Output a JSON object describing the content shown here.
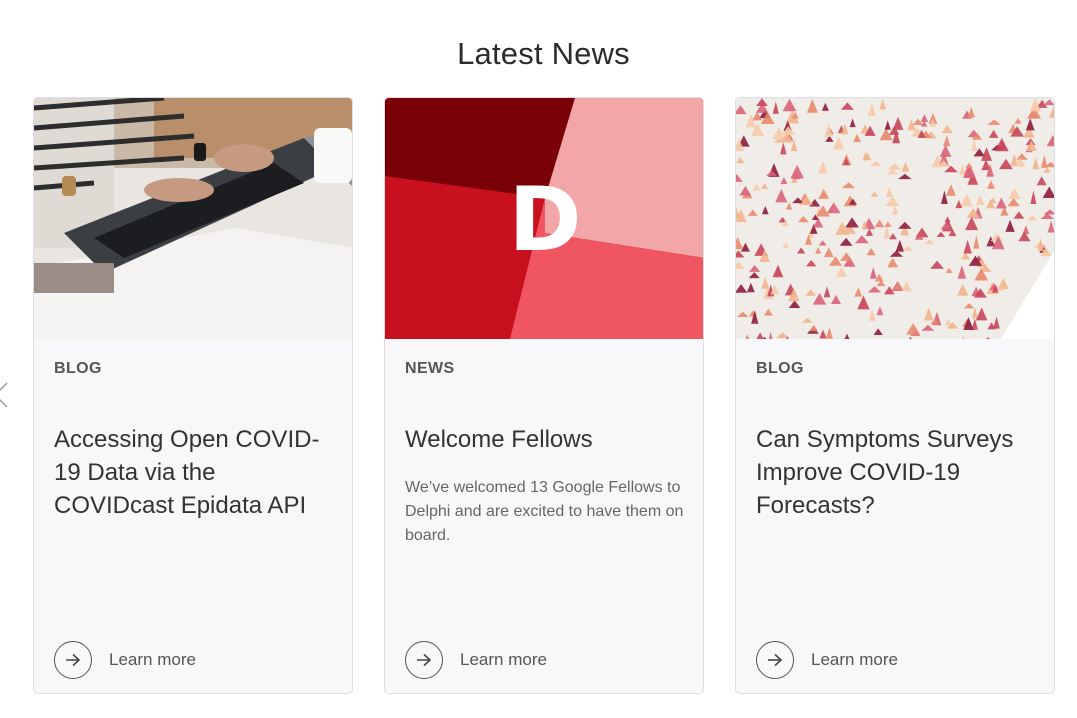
{
  "section": {
    "title": "Latest News"
  },
  "cards": [
    {
      "category": "BLOG",
      "title": "Accessing Open COVID-19 Data via the COVIDcast Epidata API",
      "description": "",
      "link_label": "Learn more",
      "image": "laptop-photo"
    },
    {
      "category": "NEWS",
      "title": "Welcome Fellows",
      "description": "We’ve welcomed 13 Google Fellows to Delphi and are excited to have them on board.",
      "link_label": "Learn more",
      "image": "delphi-logo",
      "logo_letter": "D"
    },
    {
      "category": "BLOG",
      "title": "Can Symptoms Surveys Improve COVID-19 Forecasts?",
      "description": "",
      "link_label": "Learn more",
      "image": "symptom-map"
    }
  ],
  "colors": {
    "card_bg": "#f8f8fa",
    "delphi_dark_red": "#7a0008",
    "delphi_red": "#c8101e",
    "delphi_pink": "#f3a6a7",
    "delphi_coral": "#ef5661"
  },
  "icons": {
    "prev": "chevron-left-icon",
    "link": "arrow-right-icon"
  }
}
